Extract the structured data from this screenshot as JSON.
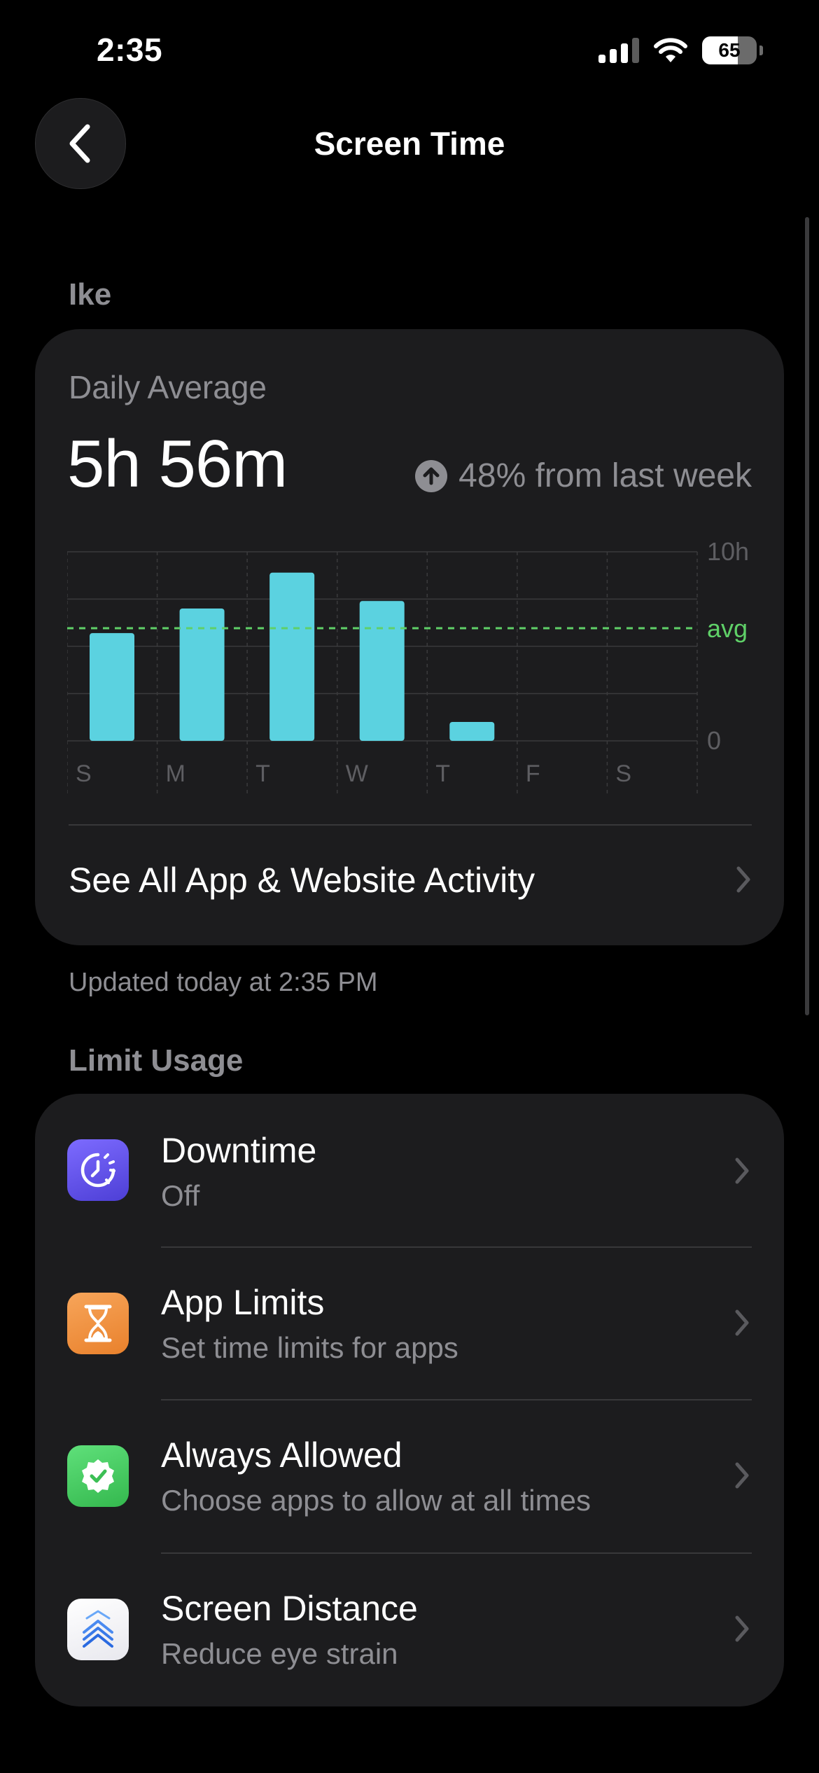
{
  "status": {
    "time": "2:35",
    "battery": "65"
  },
  "nav": {
    "title": "Screen Time",
    "back_icon": "chevron-left-icon"
  },
  "user_section": {
    "label": "Ike"
  },
  "summary": {
    "daily_label": "Daily Average",
    "daily_value": "5h 56m",
    "change_text": "48% from last week",
    "change_icon": "arrow-up-circle-icon",
    "link_label": "See All App & Website Activity"
  },
  "chart_data": {
    "type": "bar",
    "categories": [
      "S",
      "M",
      "T",
      "W",
      "T",
      "F",
      "S"
    ],
    "values": [
      5.7,
      7.0,
      8.9,
      7.4,
      1.0,
      0,
      0
    ],
    "ylim": [
      0,
      10
    ],
    "y_tick_labels": [
      "10h",
      "avg",
      "0"
    ],
    "average": 5.96,
    "bar_color": "#5bd2e0",
    "avg_color": "#5fd068"
  },
  "updated_text": "Updated today at 2:35 PM",
  "limit_section": {
    "label": "Limit Usage",
    "rows": [
      {
        "title": "Downtime",
        "subtitle": "Off",
        "icon": "downtime-icon",
        "color": "#5e5ce6"
      },
      {
        "title": "App Limits",
        "subtitle": "Set time limits for apps",
        "icon": "hourglass-icon",
        "color": "#f2994a"
      },
      {
        "title": "Always Allowed",
        "subtitle": "Choose apps to allow at all times",
        "icon": "checkmark-badge-icon",
        "color": "#4cd964"
      },
      {
        "title": "Screen Distance",
        "subtitle": "Reduce eye strain",
        "icon": "screen-distance-icon",
        "color": "#ffffff"
      }
    ]
  }
}
